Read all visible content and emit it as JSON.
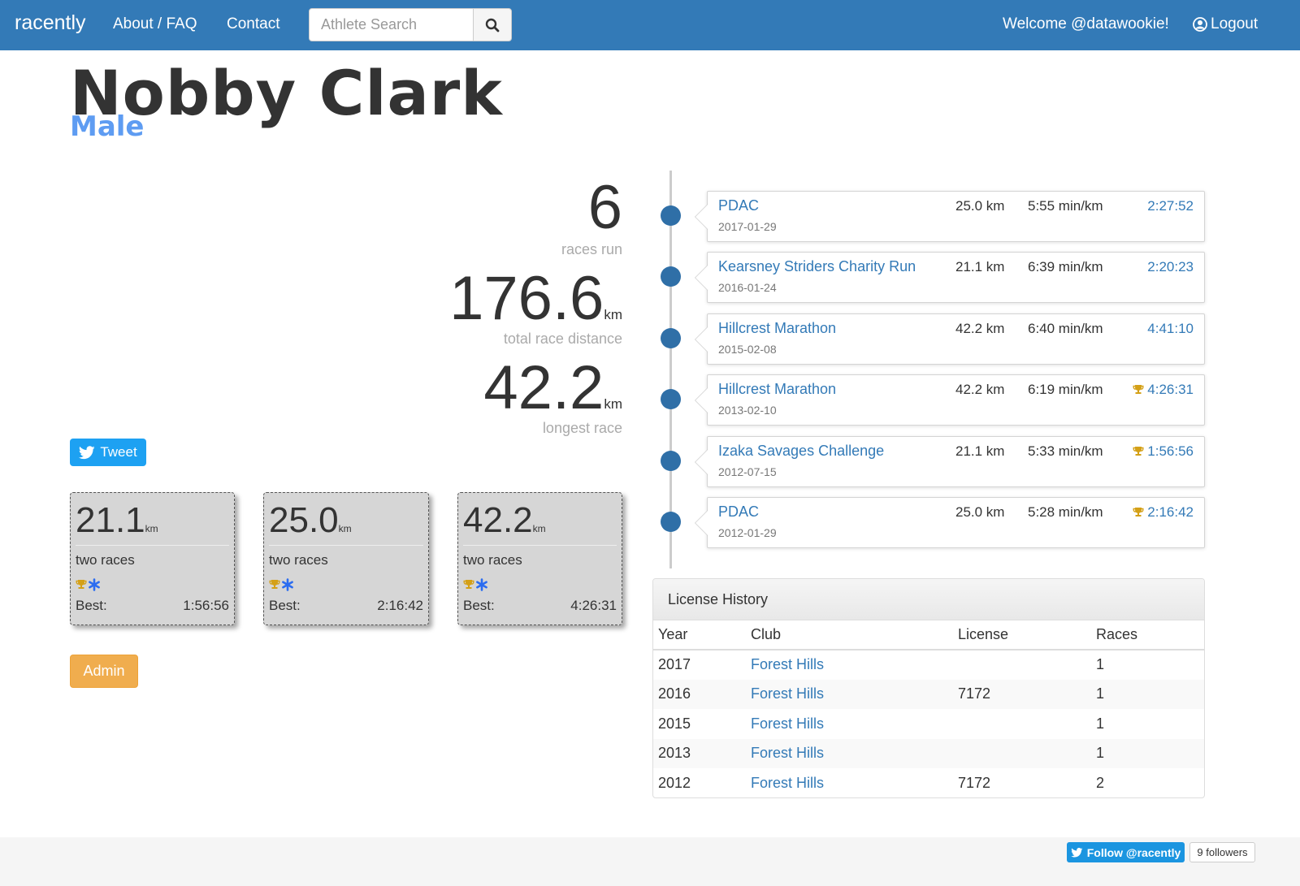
{
  "navbar": {
    "brand": "racently",
    "about_label": "About / FAQ",
    "contact_label": "Contact",
    "search_placeholder": "Athlete Search",
    "welcome": "Welcome @datawookie!",
    "logout_label": "Logout"
  },
  "athlete": {
    "name": "Nobby Clark",
    "gender": "Male"
  },
  "stats": {
    "races_run": "6",
    "races_run_label": "races run",
    "total_distance": "176.6",
    "total_distance_unit": "km",
    "total_distance_label": "total race distance",
    "longest_race": "42.2",
    "longest_race_unit": "km",
    "longest_race_label": "longest race"
  },
  "tweet_label": "Tweet",
  "cards": [
    {
      "distance": "21.1",
      "unit": "km",
      "count": "two races",
      "best_label": "Best:",
      "best_time": "1:56:56"
    },
    {
      "distance": "25.0",
      "unit": "km",
      "count": "two races",
      "best_label": "Best:",
      "best_time": "2:16:42"
    },
    {
      "distance": "42.2",
      "unit": "km",
      "count": "two races",
      "best_label": "Best:",
      "best_time": "4:26:31"
    }
  ],
  "admin_label": "Admin",
  "races": [
    {
      "name": "PDAC",
      "date": "2017-01-29",
      "distance": "25.0 km",
      "pace": "5:55 min/km",
      "time": "2:27:52",
      "trophy": false
    },
    {
      "name": "Kearsney Striders Charity Run",
      "date": "2016-01-24",
      "distance": "21.1 km",
      "pace": "6:39 min/km",
      "time": "2:20:23",
      "trophy": false
    },
    {
      "name": "Hillcrest Marathon",
      "date": "2015-02-08",
      "distance": "42.2 km",
      "pace": "6:40 min/km",
      "time": "4:41:10",
      "trophy": false
    },
    {
      "name": "Hillcrest Marathon",
      "date": "2013-02-10",
      "distance": "42.2 km",
      "pace": "6:19 min/km",
      "time": "4:26:31",
      "trophy": true
    },
    {
      "name": "Izaka Savages Challenge",
      "date": "2012-07-15",
      "distance": "21.1 km",
      "pace": "5:33 min/km",
      "time": "1:56:56",
      "trophy": true
    },
    {
      "name": "PDAC",
      "date": "2012-01-29",
      "distance": "25.0 km",
      "pace": "5:28 min/km",
      "time": "2:16:42",
      "trophy": true
    }
  ],
  "license": {
    "title": "License History",
    "headers": [
      "Year",
      "Club",
      "License",
      "Races"
    ],
    "rows": [
      {
        "year": "2017",
        "club": "Forest Hills",
        "license": "",
        "races": "1"
      },
      {
        "year": "2016",
        "club": "Forest Hills",
        "license": "7172",
        "races": "1"
      },
      {
        "year": "2015",
        "club": "Forest Hills",
        "license": "",
        "races": "1"
      },
      {
        "year": "2013",
        "club": "Forest Hills",
        "license": "",
        "races": "1"
      },
      {
        "year": "2012",
        "club": "Forest Hills",
        "license": "7172",
        "races": "2"
      }
    ]
  },
  "footer": {
    "follow_label": "Follow @racently",
    "followers": "9 followers"
  },
  "colors": {
    "navbar": "#337ab7",
    "link": "#337ab7",
    "gender": "#5e9cf2",
    "trophy": "#d4a017",
    "snowflake": "#2b6cf0",
    "admin": "#f0ad4e",
    "twitter": "#1da1f2"
  },
  "icons": [
    "search-icon",
    "user-circle-icon",
    "twitter-bird-icon",
    "trophy-icon",
    "snowflake-icon"
  ]
}
